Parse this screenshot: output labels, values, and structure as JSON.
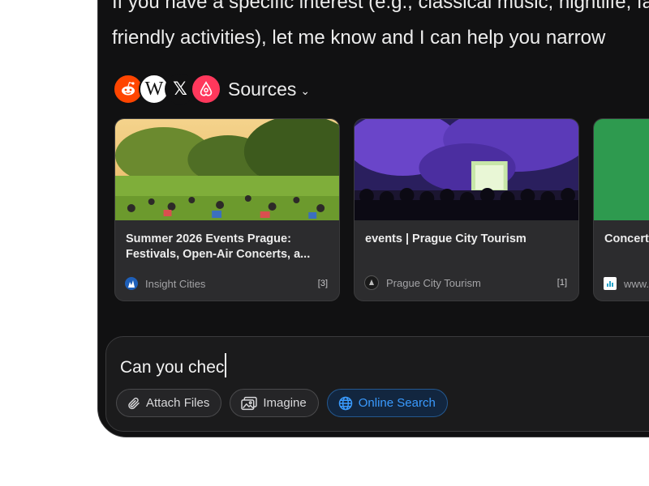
{
  "answer": {
    "line1": "If you have a specific interest (e.g., classical music, nightlife, family-",
    "line2": "friendly activities), let me know and I can help you narrow"
  },
  "sources": {
    "label": "Sources",
    "icons": [
      "reddit-icon",
      "wikipedia-icon",
      "x-icon",
      "airbnb-icon"
    ],
    "wiki_glyph": "W",
    "x_glyph": "𝕏"
  },
  "cards": [
    {
      "title": "Summer 2026 Events Prague: Festivals, Open-Air Concerts, a...",
      "site": "Insight Cities",
      "cite": "[3]"
    },
    {
      "title": "events | Prague City Tourism",
      "site": "Prague City Tourism",
      "cite": "[1]"
    },
    {
      "title": "Concerts in Prague,",
      "site": "www.",
      "cite": ""
    }
  ],
  "composer": {
    "value": "Can you chec"
  },
  "tools": [
    {
      "label": "Attach Files",
      "icon": "paperclip-icon"
    },
    {
      "label": "Imagine",
      "icon": "image-icon"
    },
    {
      "label": "Online Search",
      "icon": "globe-icon",
      "active": true
    }
  ],
  "colors": {
    "accent": "#3a9bff",
    "reddit": "#ff4500",
    "airbnb": "#ff385c"
  }
}
